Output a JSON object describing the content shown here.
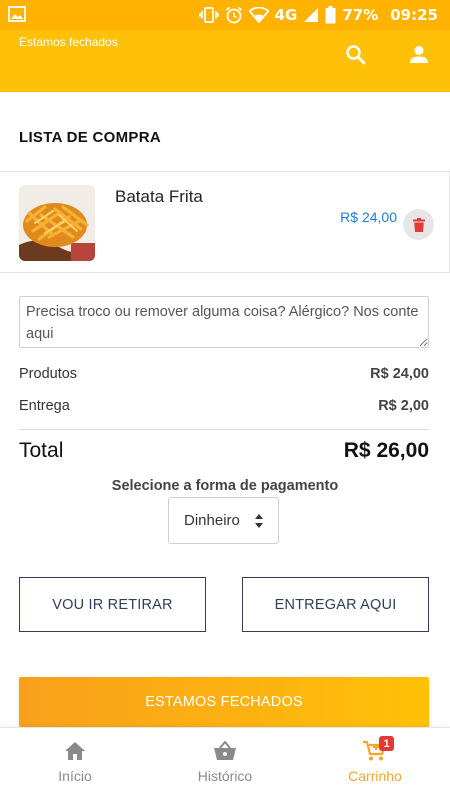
{
  "status_bar": {
    "battery": "77%",
    "time": "09:25",
    "network": "4G"
  },
  "header": {
    "status_text": "Estamos fechados",
    "search_icon": "search-icon",
    "account_icon": "account-icon",
    "brand_color": "#ffc107"
  },
  "cart": {
    "title": "LISTA DE COMPRA",
    "items": [
      {
        "name": "Batata Frita",
        "price": "R$ 24,00",
        "image": "fries-image"
      }
    ]
  },
  "notes": {
    "placeholder": "Precisa troco ou remover alguma coisa? Alérgico? Nos conte aqui",
    "value": ""
  },
  "summary": {
    "products_label": "Produtos",
    "products_value": "R$ 24,00",
    "delivery_label": "Entrega",
    "delivery_value": "R$ 2,00",
    "total_label": "Total",
    "total_value": "R$ 26,00"
  },
  "payment": {
    "title": "Selecione a forma de pagamento",
    "selected": "Dinheiro"
  },
  "actions": {
    "pickup_label": "VOU IR RETIRAR",
    "delivery_label": "ENTREGAR AQUI",
    "closed_label": "ESTAMOS FECHADOS"
  },
  "bottom_nav": {
    "items": [
      {
        "label": "Início",
        "icon": "home-icon"
      },
      {
        "label": "Histórico",
        "icon": "basket-icon"
      },
      {
        "label": "Carrinho",
        "icon": "cart-icon",
        "badge": "1",
        "active": true
      }
    ],
    "active_color": "#f5a623"
  }
}
